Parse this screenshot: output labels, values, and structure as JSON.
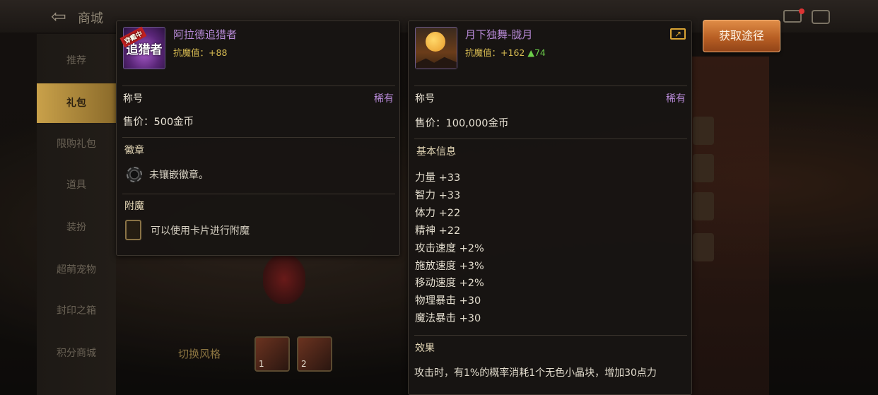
{
  "background": {
    "shop_title": "商城",
    "top_badge": "",
    "sidebar": [
      {
        "label": "推荐"
      },
      {
        "label": "礼包"
      },
      {
        "label": "限购礼包"
      },
      {
        "label": "道具"
      },
      {
        "label": "装扮"
      },
      {
        "label": "超萌宠物"
      },
      {
        "label": "封印之箱"
      },
      {
        "label": "积分商城"
      }
    ],
    "style_switch": "切换风格",
    "card_thumbs": [
      "1",
      "2"
    ]
  },
  "left_panel": {
    "item_name": "阿拉德追猎者",
    "icon_text": "追猎者",
    "icon_ribbon": "穿戴中",
    "resist_label": "抗魔值：",
    "resist_value": "+88",
    "type_label": "称号",
    "rarity": "稀有",
    "price": "售价：500金币",
    "badge_heading": "徽章",
    "badge_text": "未镶嵌徽章。",
    "enchant_heading": "附魔",
    "enchant_text": "可以使用卡片进行附魔"
  },
  "right_panel": {
    "item_name": "月下独舞-胧月",
    "resist_label": "抗魔值：",
    "resist_value": "+162",
    "resist_up": "▲74",
    "type_label": "称号",
    "rarity": "稀有",
    "price": "售价：100,000金币",
    "basic_heading": "基本信息",
    "stats": [
      "力量 +33",
      "智力 +33",
      "体力 +22",
      "精神 +22",
      "攻击速度 +2%",
      "施放速度 +3%",
      "移动速度 +2%",
      "物理暴击 +30",
      "魔法暴击 +30"
    ],
    "effect_heading": "效果",
    "effect_text": "攻击时，有1%的概率消耗1个无色小晶块，增加30点力"
  },
  "acquire_button": "获取途径",
  "colors": {
    "rarity": "#b88ad8",
    "resist": "#d8bc52",
    "up_arrow": "#6ccd4a",
    "button": "#b85f24"
  }
}
